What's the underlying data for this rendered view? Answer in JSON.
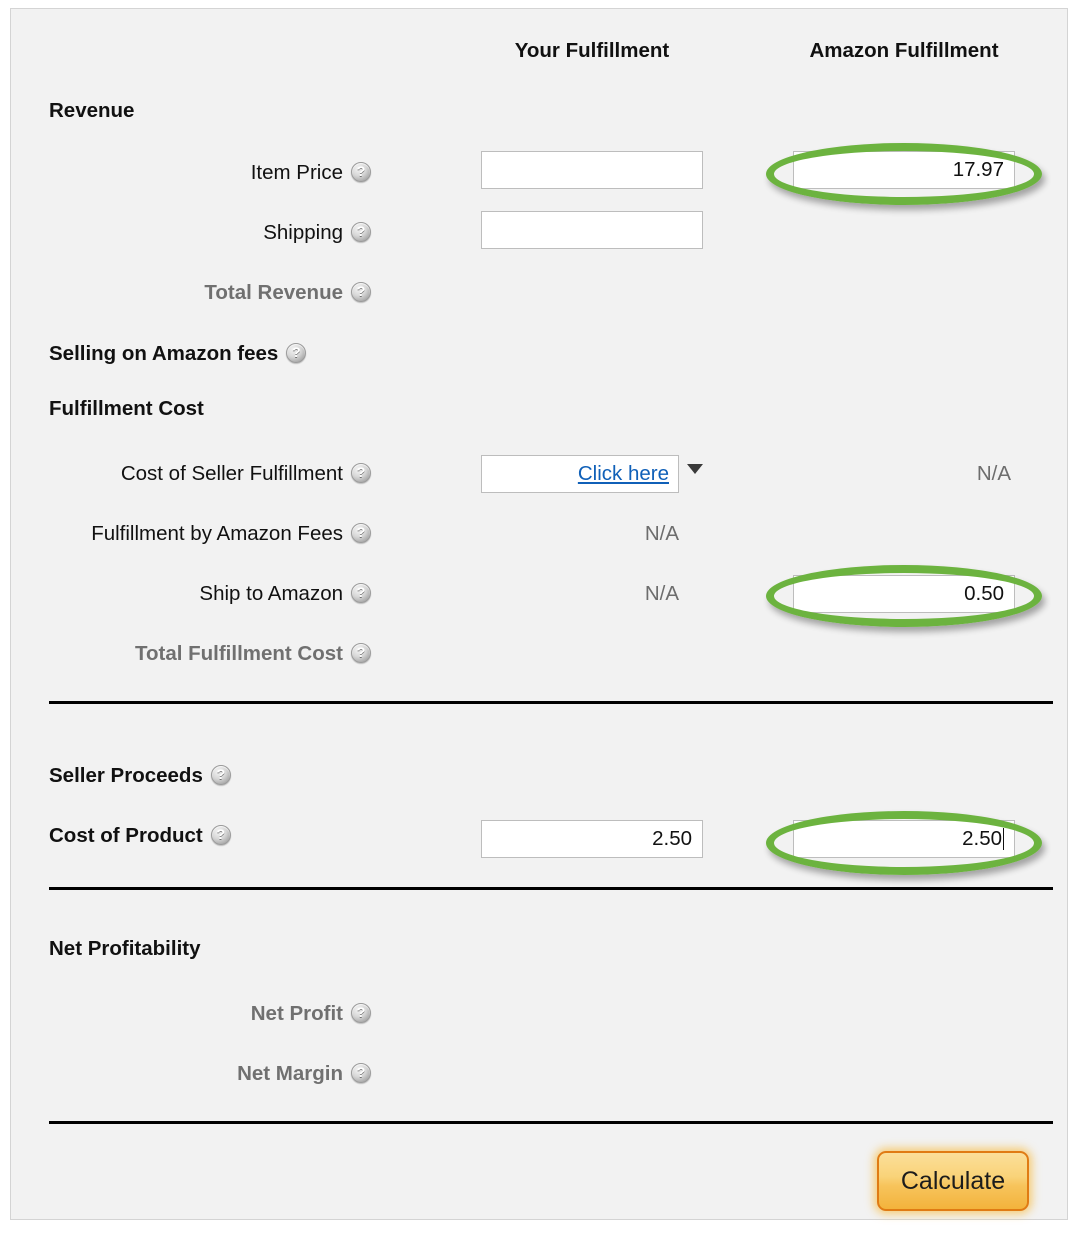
{
  "columns": {
    "your": "Your Fulfillment",
    "amazon": "Amazon Fulfillment"
  },
  "sections": {
    "revenue": "Revenue",
    "selling_fees": "Selling on Amazon fees",
    "fulfillment_cost": "Fulfillment Cost",
    "seller_proceeds": "Seller Proceeds",
    "cost_of_product": "Cost of Product",
    "net_profitability": "Net Profitability"
  },
  "rows": {
    "item_price": {
      "label": "Item Price",
      "your_value": "",
      "amazon_value": "17.97"
    },
    "shipping": {
      "label": "Shipping",
      "your_value": "",
      "amazon_value": ""
    },
    "total_revenue": {
      "label": "Total Revenue"
    },
    "cost_of_seller_fulfillment": {
      "label": "Cost of Seller Fulfillment",
      "your_value": "Click here",
      "amazon_value": "N/A"
    },
    "fulfillment_by_amazon_fees": {
      "label": "Fulfillment by Amazon Fees",
      "your_value": "N/A"
    },
    "ship_to_amazon": {
      "label": "Ship to Amazon",
      "your_value": "N/A",
      "amazon_value": "0.50"
    },
    "total_fulfillment_cost": {
      "label": "Total Fulfillment Cost"
    },
    "cost_of_product": {
      "label": "Cost of Product",
      "your_value": "2.50",
      "amazon_value": "2.50"
    },
    "net_profit": {
      "label": "Net Profit"
    },
    "net_margin": {
      "label": "Net Margin"
    }
  },
  "actions": {
    "calculate": "Calculate"
  },
  "icons": {
    "help": "help-icon",
    "dropdown": "chevron-down-icon"
  },
  "colors": {
    "highlight_ring": "#6cb33f",
    "link": "#1060b8",
    "button_border": "#e07b13",
    "panel_bg": "#f2f2f2",
    "muted_text": "#707070"
  }
}
